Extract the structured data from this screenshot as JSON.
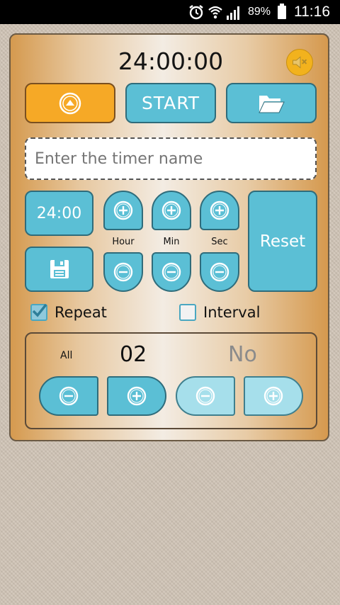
{
  "status_bar": {
    "battery_percent": "89%",
    "time": "11:16",
    "icons": [
      "alarm-icon",
      "wifi-icon",
      "signal-icon",
      "battery-icon"
    ]
  },
  "timer": {
    "display": "24:00:00",
    "mute_icon": "speaker-muted-icon"
  },
  "toolbar": {
    "start_label": "START",
    "up_icon": "arrow-up-circle-icon",
    "folder_icon": "folder-open-icon"
  },
  "name_input": {
    "placeholder": "Enter the timer name",
    "value": ""
  },
  "adjust": {
    "preset_label": "24:00",
    "save_icon": "floppy-disk-icon",
    "units": [
      "Hour",
      "Min",
      "Sec"
    ],
    "reset_label": "Reset"
  },
  "options": {
    "repeat_label": "Repeat",
    "repeat_checked": true,
    "interval_label": "Interval",
    "interval_checked": false
  },
  "repeat_panel": {
    "all_label": "All",
    "count": "02",
    "interval_value": "No"
  },
  "colors": {
    "accent_blue": "#5bbfd5",
    "accent_orange": "#f6a926",
    "disabled_blue": "#a6dfeb"
  }
}
